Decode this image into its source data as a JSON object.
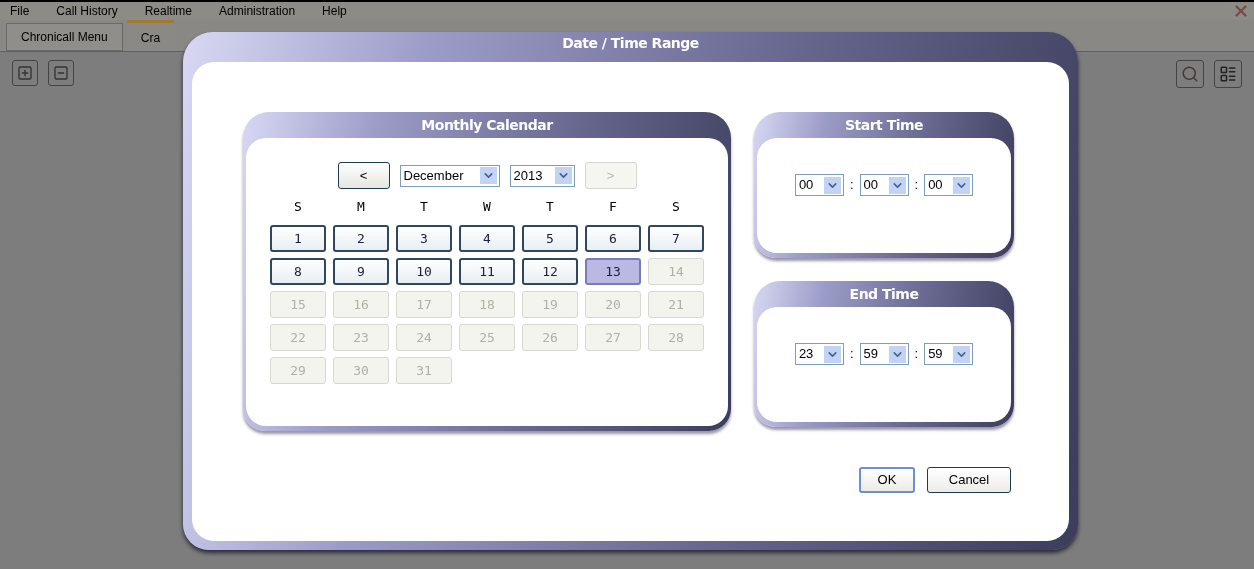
{
  "menu": [
    "File",
    "Call History",
    "Realtime",
    "Administration",
    "Help"
  ],
  "tabs": [
    {
      "label": "Chronicall Menu",
      "selected": false
    },
    {
      "label": "Cra",
      "selected": true
    }
  ],
  "dialog": {
    "title": "Date / Time Range",
    "calendar": {
      "title": "Monthly Calendar",
      "prev": {
        "label": "<",
        "disabled": false
      },
      "month": "December",
      "year": "2013",
      "next": {
        "label": ">",
        "disabled": true
      },
      "weekdays": [
        "S",
        "M",
        "T",
        "W",
        "T",
        "F",
        "S"
      ],
      "days": [
        {
          "label": "1",
          "disabled": false,
          "selected": false
        },
        {
          "label": "2",
          "disabled": false,
          "selected": false
        },
        {
          "label": "3",
          "disabled": false,
          "selected": false
        },
        {
          "label": "4",
          "disabled": false,
          "selected": false
        },
        {
          "label": "5",
          "disabled": false,
          "selected": false
        },
        {
          "label": "6",
          "disabled": false,
          "selected": false
        },
        {
          "label": "7",
          "disabled": false,
          "selected": false
        },
        {
          "label": "8",
          "disabled": false,
          "selected": false
        },
        {
          "label": "9",
          "disabled": false,
          "selected": false
        },
        {
          "label": "10",
          "disabled": false,
          "selected": false
        },
        {
          "label": "11",
          "disabled": false,
          "selected": false
        },
        {
          "label": "12",
          "disabled": false,
          "selected": false
        },
        {
          "label": "13",
          "disabled": false,
          "selected": true
        },
        {
          "label": "14",
          "disabled": true,
          "selected": false
        },
        {
          "label": "15",
          "disabled": true,
          "selected": false
        },
        {
          "label": "16",
          "disabled": true,
          "selected": false
        },
        {
          "label": "17",
          "disabled": true,
          "selected": false
        },
        {
          "label": "18",
          "disabled": true,
          "selected": false
        },
        {
          "label": "19",
          "disabled": true,
          "selected": false
        },
        {
          "label": "20",
          "disabled": true,
          "selected": false
        },
        {
          "label": "21",
          "disabled": true,
          "selected": false
        },
        {
          "label": "22",
          "disabled": true,
          "selected": false
        },
        {
          "label": "23",
          "disabled": true,
          "selected": false
        },
        {
          "label": "24",
          "disabled": true,
          "selected": false
        },
        {
          "label": "25",
          "disabled": true,
          "selected": false
        },
        {
          "label": "26",
          "disabled": true,
          "selected": false
        },
        {
          "label": "27",
          "disabled": true,
          "selected": false
        },
        {
          "label": "28",
          "disabled": true,
          "selected": false
        },
        {
          "label": "29",
          "disabled": true,
          "selected": false
        },
        {
          "label": "30",
          "disabled": true,
          "selected": false
        },
        {
          "label": "31",
          "disabled": true,
          "selected": false
        }
      ]
    },
    "times": [
      {
        "title": "Start Time",
        "values": [
          "00",
          "00",
          "00"
        ],
        "separators": [
          ":",
          ":"
        ]
      },
      {
        "title": "End Time",
        "values": [
          "23",
          "59",
          "59"
        ],
        "separators": [
          ":",
          ":"
        ]
      }
    ],
    "buttons": [
      {
        "label": "OK",
        "default": true
      },
      {
        "label": "Cancel",
        "default": false
      }
    ]
  }
}
